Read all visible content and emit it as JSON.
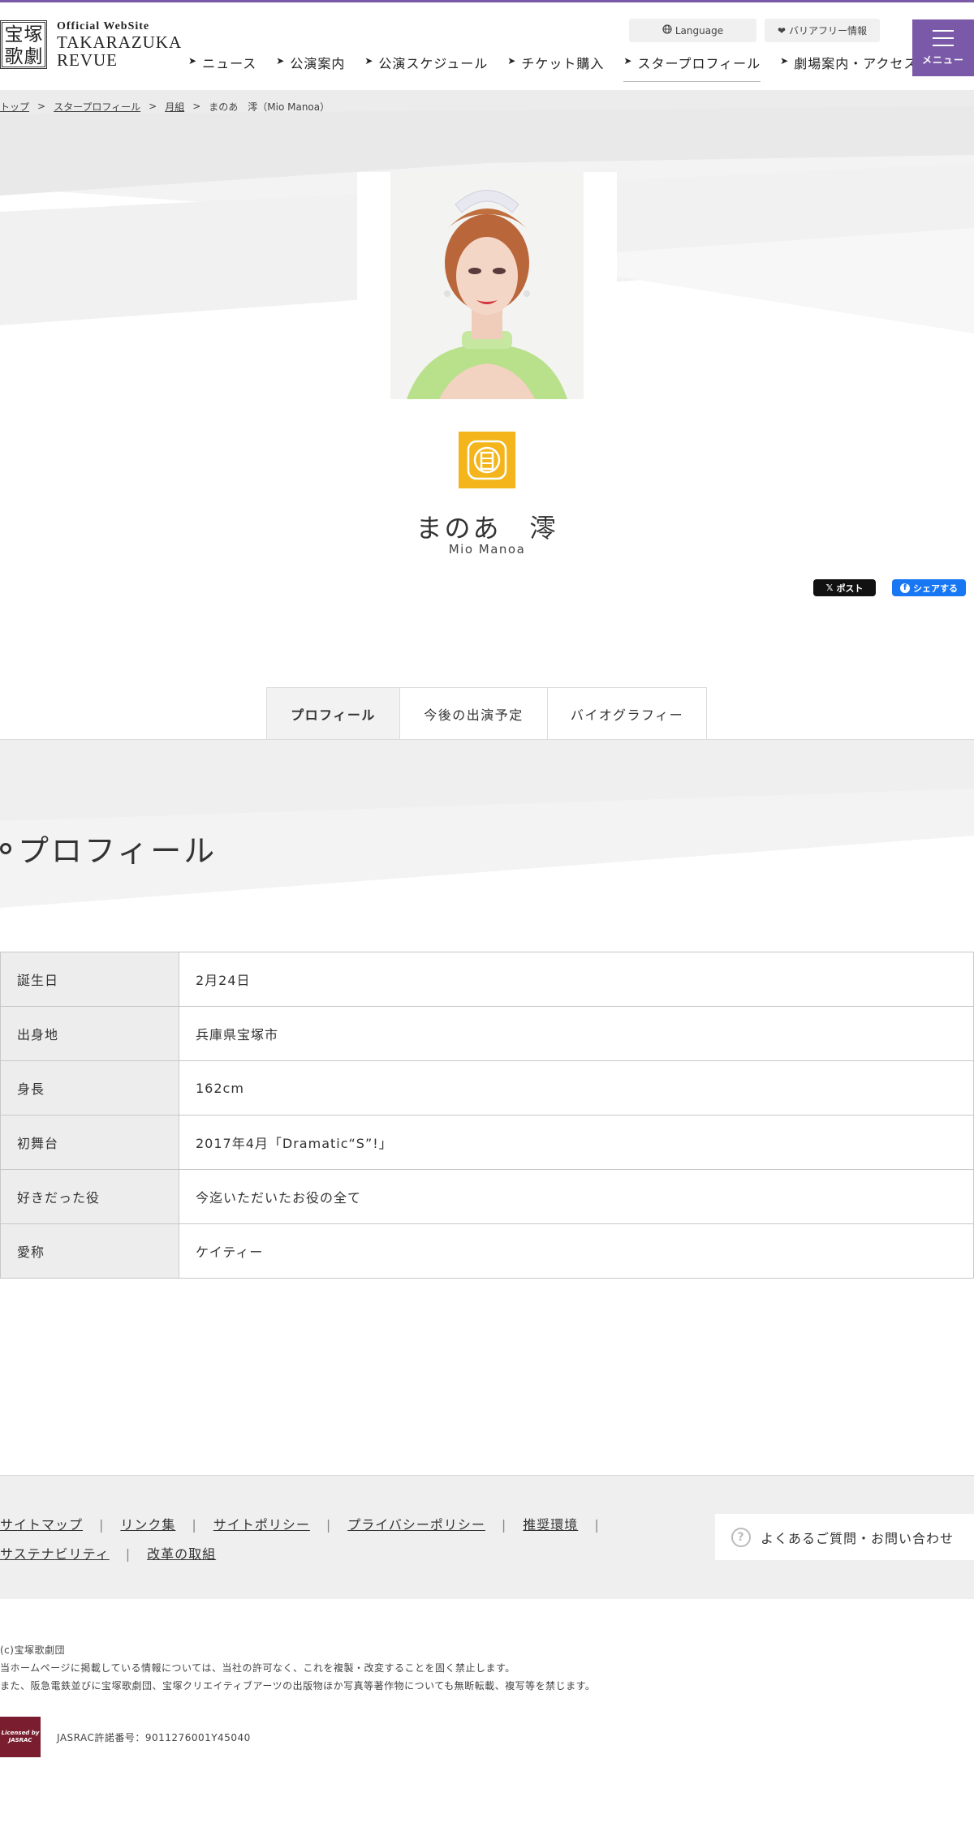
{
  "header": {
    "logo_kanji": [
      "宝",
      "塚",
      "歌",
      "劇"
    ],
    "logo_small": "Official WebSite",
    "logo_line1": "TAKARAZUKA",
    "logo_line2": "REVUE",
    "language_label": "Language",
    "barrier_free_label": "バリアフリー情報",
    "menu_label": "メニュー"
  },
  "nav": [
    {
      "label": "ニュース"
    },
    {
      "label": "公演案内"
    },
    {
      "label": "公演スケジュール"
    },
    {
      "label": "チケット購入"
    },
    {
      "label": "スタープロフィール"
    },
    {
      "label": "劇場案内・アクセス"
    }
  ],
  "breadcrumb": {
    "top": "トップ",
    "star_profile": "スタープロフィール",
    "troupe": "月組",
    "current": "まのあ　澪（Mio Manoa）",
    "sep": ">"
  },
  "profile": {
    "name_jp": "まのあ　澪",
    "name_en": "Mio Manoa",
    "emblem_icon": "moon-troupe-emblem-icon"
  },
  "share": {
    "x_label": "ポスト",
    "fb_label": "シェアする"
  },
  "tabs": [
    {
      "label": "プロフィール"
    },
    {
      "label": "今後の出演予定"
    },
    {
      "label": "バイオグラフィー"
    }
  ],
  "section_title": "プロフィール",
  "profile_table": [
    {
      "label": "誕生日",
      "value": "2月24日"
    },
    {
      "label": "出身地",
      "value": "兵庫県宝塚市"
    },
    {
      "label": "身長",
      "value": "162cm"
    },
    {
      "label": "初舞台",
      "value": "2017年4月「Dramatic“S”!」"
    },
    {
      "label": "好きだった役",
      "value": "今迄いただいたお役の全て"
    },
    {
      "label": "愛称",
      "value": "ケイティー"
    }
  ],
  "footer": {
    "links_row1": [
      "サイトマップ",
      "リンク集",
      "サイトポリシー",
      "プライバシーポリシー",
      "推奨環境"
    ],
    "links_row2": [
      "サステナビリティ",
      "改革の取組"
    ],
    "faq_label": "よくあるご質問・お問い合わせ",
    "copyright": "(c)宝塚歌劇団",
    "notice1": "当ホームページに掲載している情報については、当社の許可なく、これを複製・改変することを固く禁止します。",
    "notice2": "また、阪急電鉄並びに宝塚歌劇団、宝塚クリエイティブアーツの出版物ほか写真等著作物についても無断転載、複写等を禁じます。",
    "jasrac_logo_text": "Licensed by JASRAC",
    "jasrac_number": "JASRAC許諾番号：9011276001Y45040"
  },
  "colors": {
    "brand_purple": "#7a5aa8",
    "emblem_yellow": "#f3b51b",
    "facebook_blue": "#1877f2"
  }
}
